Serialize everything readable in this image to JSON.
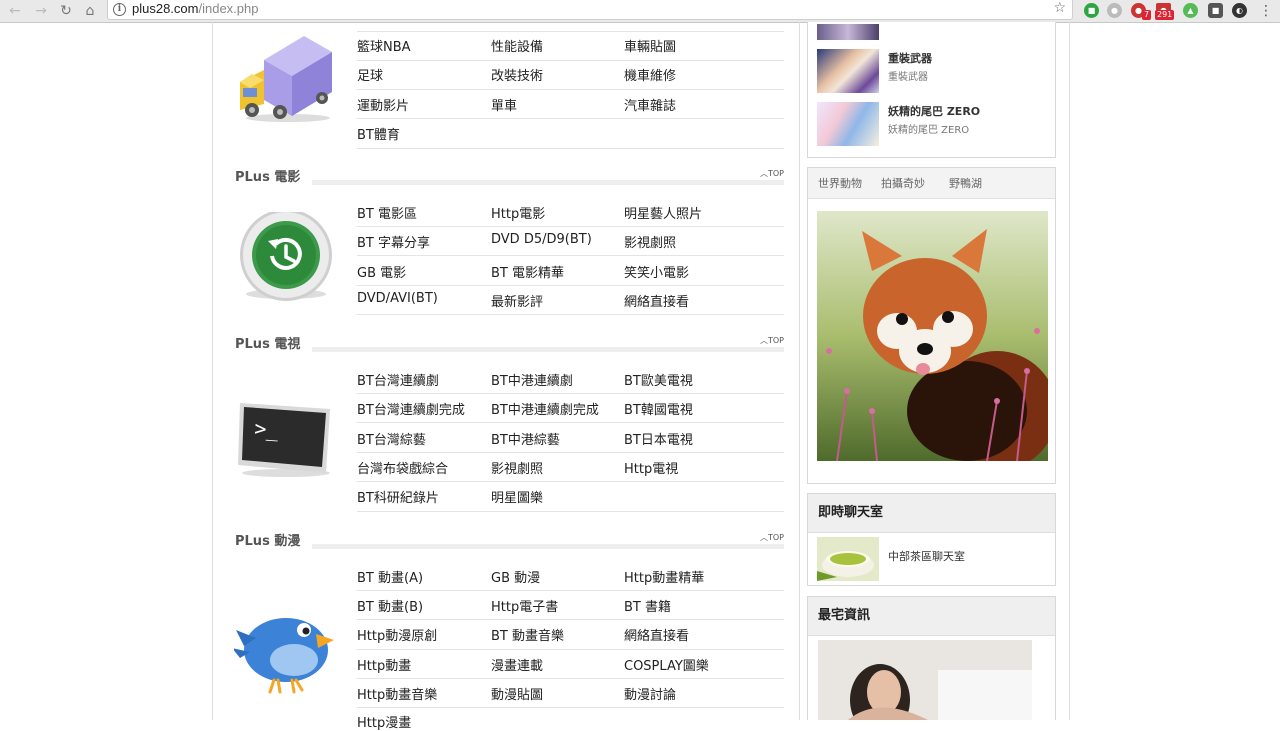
{
  "browser": {
    "url_host": "plus28.com",
    "url_path": "/index.php",
    "ext_badges": [
      "7",
      "291"
    ]
  },
  "sections": {
    "sports_links": [
      [
        "籃球NBA",
        "性能設備",
        "車輛貼圖"
      ],
      [
        "足球",
        "改裝技術",
        "機車維修"
      ],
      [
        "運動影片",
        "單車",
        "汽車雜誌"
      ],
      [
        "BT體育",
        "",
        ""
      ]
    ],
    "movie_title": "PLus 電影",
    "movie_links": [
      [
        "BT 電影區",
        "Http電影",
        "明星藝人照片"
      ],
      [
        "BT 字幕分享",
        "DVD D5/D9(BT)",
        "影視劇照"
      ],
      [
        "GB 電影",
        "BT 電影精華",
        "笑笑小電影"
      ],
      [
        "DVD/AVI(BT)",
        "最新影評",
        "網絡直接看"
      ]
    ],
    "tv_title": "PLus 電視",
    "tv_links": [
      [
        "BT台灣連續劇",
        "BT中港連續劇",
        "BT歐美電視"
      ],
      [
        "BT台灣連續劇完成",
        "BT中港連續劇完成",
        "BT韓國電視"
      ],
      [
        "BT台灣綜藝",
        "BT中港綜藝",
        "BT日本電視"
      ],
      [
        "台灣布袋戲綜合",
        "影視劇照",
        "Http電視"
      ],
      [
        "BT科研紀錄片",
        "明星圖樂",
        ""
      ]
    ],
    "anime_title": "PLus 動漫",
    "anime_links": [
      [
        "BT 動畫(A)",
        "GB 動漫",
        "Http動畫精華"
      ],
      [
        "BT 動畫(B)",
        "Http電子書",
        "BT 書籍"
      ],
      [
        "Http動漫原創",
        "BT 動畫音樂",
        "網絡直接看"
      ],
      [
        "Http動畫",
        "漫畫連載",
        "COSPLAY圖樂"
      ],
      [
        "Http動畫音樂",
        "動漫貼圖",
        "動漫討論"
      ],
      [
        "Http漫畫",
        "",
        ""
      ]
    ],
    "top_label": "TOP"
  },
  "sidebar": {
    "anime_items": [
      {
        "title": "重裝武器",
        "sub": "重裝武器"
      },
      {
        "title": "妖精的尾巴 ZERO",
        "sub": "妖精的尾巴 ZERO"
      }
    ],
    "tabs": [
      "世界動物",
      "拍攝奇妙",
      "野鴨湖"
    ],
    "chat_title": "即時聊天室",
    "chat_item": "中部茶區聊天室",
    "news_title": "最宅資訊"
  }
}
